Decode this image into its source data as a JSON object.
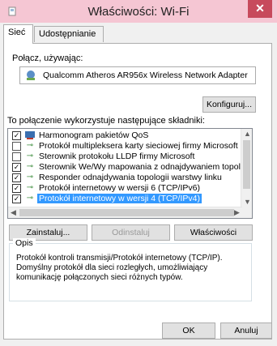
{
  "window": {
    "title": "Właściwości: Wi-Fi",
    "close_glyph": "✕"
  },
  "tabs": [
    {
      "label": "Sieć"
    },
    {
      "label": "Udostępnianie"
    }
  ],
  "connect_using": {
    "label": "Połącz, używając:",
    "adapter": "Qualcomm Atheros AR956x Wireless Network Adapter"
  },
  "configure_button": "Konfiguruj...",
  "components": {
    "label": "To połączenie wykorzystuje następujące składniki:",
    "items": [
      {
        "checked": true,
        "icon": "qos-scheduler-icon",
        "label": "Harmonogram pakietów QoS",
        "selected": false
      },
      {
        "checked": false,
        "icon": "protocol-icon",
        "label": "Protokół multipleksera karty sieciowej firmy Microsoft",
        "selected": false
      },
      {
        "checked": false,
        "icon": "protocol-icon",
        "label": "Sterownik protokołu LLDP firmy Microsoft",
        "selected": false
      },
      {
        "checked": true,
        "icon": "protocol-icon",
        "label": "Sterownik We/Wy mapowania z odnajdywaniem topolo",
        "selected": false
      },
      {
        "checked": true,
        "icon": "protocol-icon",
        "label": "Responder odnajdywania topologii warstwy linku",
        "selected": false
      },
      {
        "checked": true,
        "icon": "protocol-icon",
        "label": "Protokół internetowy w wersji 6 (TCP/IPv6)",
        "selected": false
      },
      {
        "checked": true,
        "icon": "protocol-icon",
        "label": "Protokół internetowy w wersji 4 (TCP/IPv4)",
        "selected": true
      }
    ]
  },
  "buttons": {
    "install": "Zainstaluj...",
    "uninstall": "Odinstaluj",
    "properties": "Właściwości"
  },
  "description": {
    "title": "Opis",
    "text": "Protokół kontroli transmisji/Protokół internetowy (TCP/IP). Domyślny protokół dla sieci rozległych, umożliwiający komunikację połączonych sieci różnych typów."
  },
  "footer": {
    "ok": "OK",
    "cancel": "Anuluj"
  },
  "colors": {
    "titlebar": "#f5c6d3",
    "close": "#c74a5c",
    "selection": "#3399ff"
  }
}
